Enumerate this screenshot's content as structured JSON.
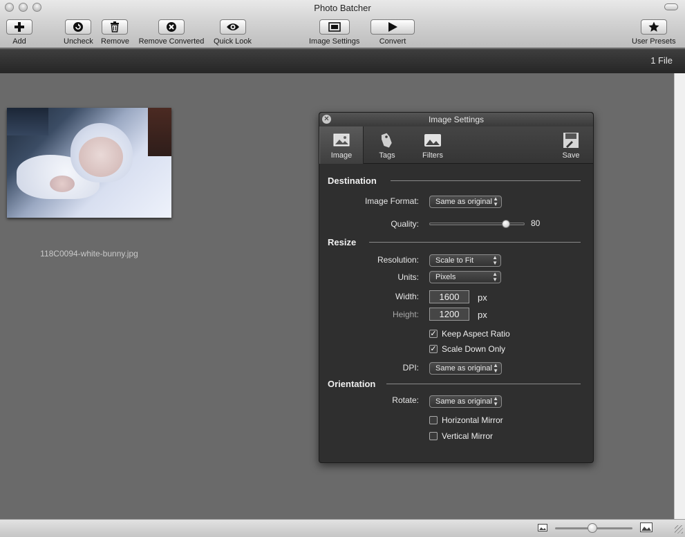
{
  "window": {
    "title": "Photo Batcher"
  },
  "toolbar": {
    "add": "Add",
    "uncheck": "Uncheck",
    "remove": "Remove",
    "remove_converted": "Remove Converted",
    "quick_look": "Quick Look",
    "image_settings": "Image Settings",
    "convert": "Convert",
    "user_presets": "User Presets"
  },
  "status": {
    "file_count": "1 File"
  },
  "files": [
    {
      "name": "118C0094-white-bunny.jpg"
    }
  ],
  "panel": {
    "title": "Image Settings",
    "tabs": {
      "image": "Image",
      "tags": "Tags",
      "filters": "Filters",
      "save": "Save"
    },
    "destination": {
      "heading": "Destination",
      "image_format_label": "Image Format:",
      "image_format_value": "Same as original",
      "quality_label": "Quality:",
      "quality_value": "80"
    },
    "resize": {
      "heading": "Resize",
      "resolution_label": "Resolution:",
      "resolution_value": "Scale to Fit",
      "units_label": "Units:",
      "units_value": "Pixels",
      "width_label": "Width:",
      "width_value": "1600",
      "height_label": "Height:",
      "height_value": "1200",
      "unit_px": "px",
      "keep_aspect": "Keep Aspect Ratio",
      "keep_aspect_checked": true,
      "scale_down": "Scale Down Only",
      "scale_down_checked": true,
      "dpi_label": "DPI:",
      "dpi_value": "Same as original"
    },
    "orientation": {
      "heading": "Orientation",
      "rotate_label": "Rotate:",
      "rotate_value": "Same as original",
      "horizontal_mirror": "Horizontal Mirror",
      "horizontal_mirror_checked": false,
      "vertical_mirror": "Vertical Mirror",
      "vertical_mirror_checked": false
    }
  },
  "zoom": {
    "level": 0.48
  }
}
